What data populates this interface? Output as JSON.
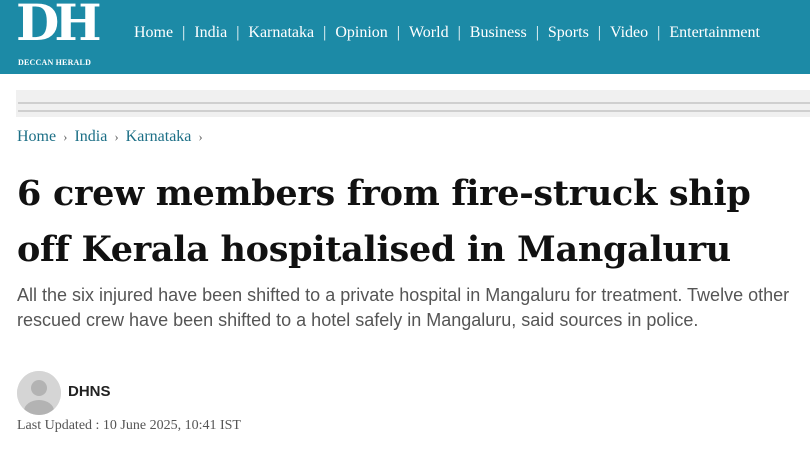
{
  "logo": {
    "mark": "DH",
    "name": "DECCAN HERALD"
  },
  "nav": {
    "items": [
      "Home",
      "India",
      "Karnataka",
      "Opinion",
      "World",
      "Business",
      "Sports",
      "Video",
      "Entertainment"
    ],
    "separator": "|"
  },
  "breadcrumb": {
    "items": [
      "Home",
      "India",
      "Karnataka"
    ],
    "separator": "›"
  },
  "article": {
    "headline": "6 crew members from fire-struck ship off Kerala hospitalised in Mangaluru",
    "summary": "All the six injured have been shifted to a private hospital in Mangaluru for treatment. Twelve other rescued crew have been shifted to a hotel safely in Mangaluru, said sources in police.",
    "author": "DHNS",
    "last_updated": "Last Updated : 10 June 2025, 10:41 IST"
  },
  "colors": {
    "brand": "#1c8aa6",
    "link": "#1c6f86",
    "headline": "#111111",
    "summary": "#555555"
  },
  "icons": {
    "avatar": "user-avatar-placeholder"
  }
}
